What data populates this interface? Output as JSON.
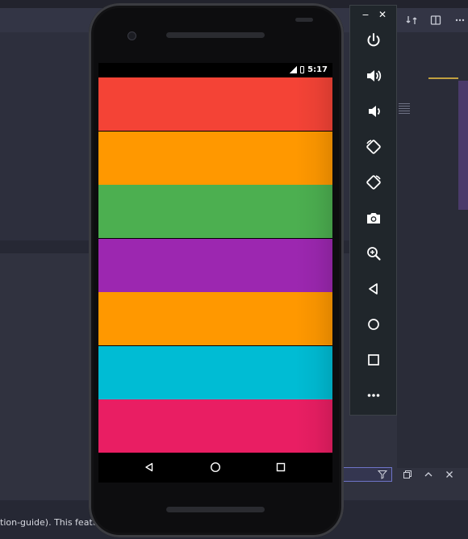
{
  "ide": {
    "status_text": "tion-guide). This featu",
    "icons": [
      "compare-icon",
      "split-view-icon",
      "more-icon"
    ]
  },
  "phone": {
    "status_time": "5:17",
    "bands": [
      "#f44336",
      "#ff9800",
      "#4caf50",
      "#9c27b0",
      "#ff9800",
      "#00bcd4",
      "#e91e63"
    ]
  },
  "toolbar": {
    "minimize_glyph": "−",
    "close_glyph": "✕",
    "buttons": [
      "power-icon",
      "volume-up-icon",
      "volume-down-icon",
      "rotate-left-icon",
      "rotate-right-icon",
      "camera-icon",
      "zoom-icon",
      "back-icon",
      "home-icon",
      "overview-icon",
      "more-icon"
    ]
  }
}
